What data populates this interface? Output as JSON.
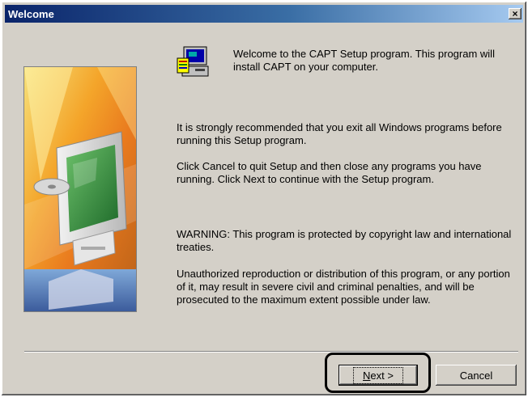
{
  "window": {
    "title": "Welcome",
    "close_label": "×"
  },
  "intro": "Welcome to the CAPT Setup program.  This program will install CAPT on your computer.",
  "paragraphs": {
    "p1": "It is strongly recommended that you exit all Windows programs before running this Setup program.",
    "p2": "Click Cancel to quit Setup and then close any programs you have running.  Click Next to continue with the Setup program.",
    "p3": "WARNING: This program is protected by copyright law and international treaties.",
    "p4": "Unauthorized reproduction or distribution of this program, or any portion of it, may result in severe civil and criminal penalties, and will be prosecuted to the maximum extent possible under law."
  },
  "buttons": {
    "next_mnemonic": "N",
    "next_rest": "ext >",
    "cancel": "Cancel"
  },
  "icons": {
    "setup": "setup-computer-icon",
    "hero": "computer-monitor-illustration",
    "close": "close-icon"
  },
  "colors": {
    "dialog_bg": "#d4d0c8",
    "titlebar_start": "#0a246a",
    "titlebar_end": "#a6caf0"
  }
}
